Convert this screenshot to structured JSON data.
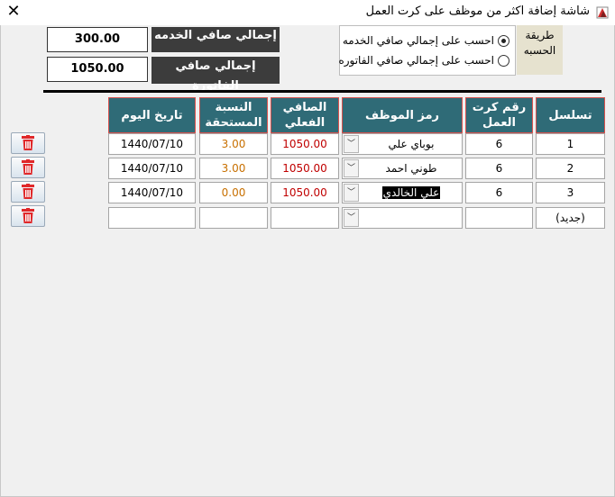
{
  "window": {
    "title": "شاشة إضافة اكثر من موظف على كرت العمل"
  },
  "totals": {
    "service_net_label": "إجمالي صافي الخدمه",
    "service_net_value": "300.00",
    "invoice_net_label": "إجمالي صافي الفاتورة",
    "invoice_net_value": "1050.00"
  },
  "calc_method": {
    "label": "طريقة الحسبه",
    "options": [
      {
        "label": "احسب على إجمالي صافي الخدمه",
        "selected": true
      },
      {
        "label": "احسب على إجمالي صافي الفاتوره",
        "selected": false
      }
    ]
  },
  "table": {
    "columns": [
      "تسلسل",
      "رقم كرت العمل",
      "رمز الموظف",
      "الصافي الفعلي",
      "النسبة المستحقة",
      "تاريخ اليوم"
    ],
    "rows": [
      {
        "seq": "1",
        "card": "6",
        "employee": "بوباي علي",
        "net": "1050.00",
        "pct": "3.00",
        "date": "1440/07/10"
      },
      {
        "seq": "2",
        "card": "6",
        "employee": "طوني احمد",
        "net": "1050.00",
        "pct": "3.00",
        "date": "1440/07/10"
      },
      {
        "seq": "3",
        "card": "6",
        "employee": "علي الخالدي",
        "net": "1050.00",
        "pct": "0.00",
        "date": "1440/07/10"
      },
      {
        "seq": "(جديد)",
        "card": "",
        "employee": "",
        "net": "",
        "pct": "",
        "date": ""
      }
    ]
  },
  "colors": {
    "header_bg": "#2f6b77",
    "header_border": "#d9534f",
    "net_text": "#c00000",
    "pct_text": "#c87000",
    "delete_icon": "#e0282a"
  }
}
